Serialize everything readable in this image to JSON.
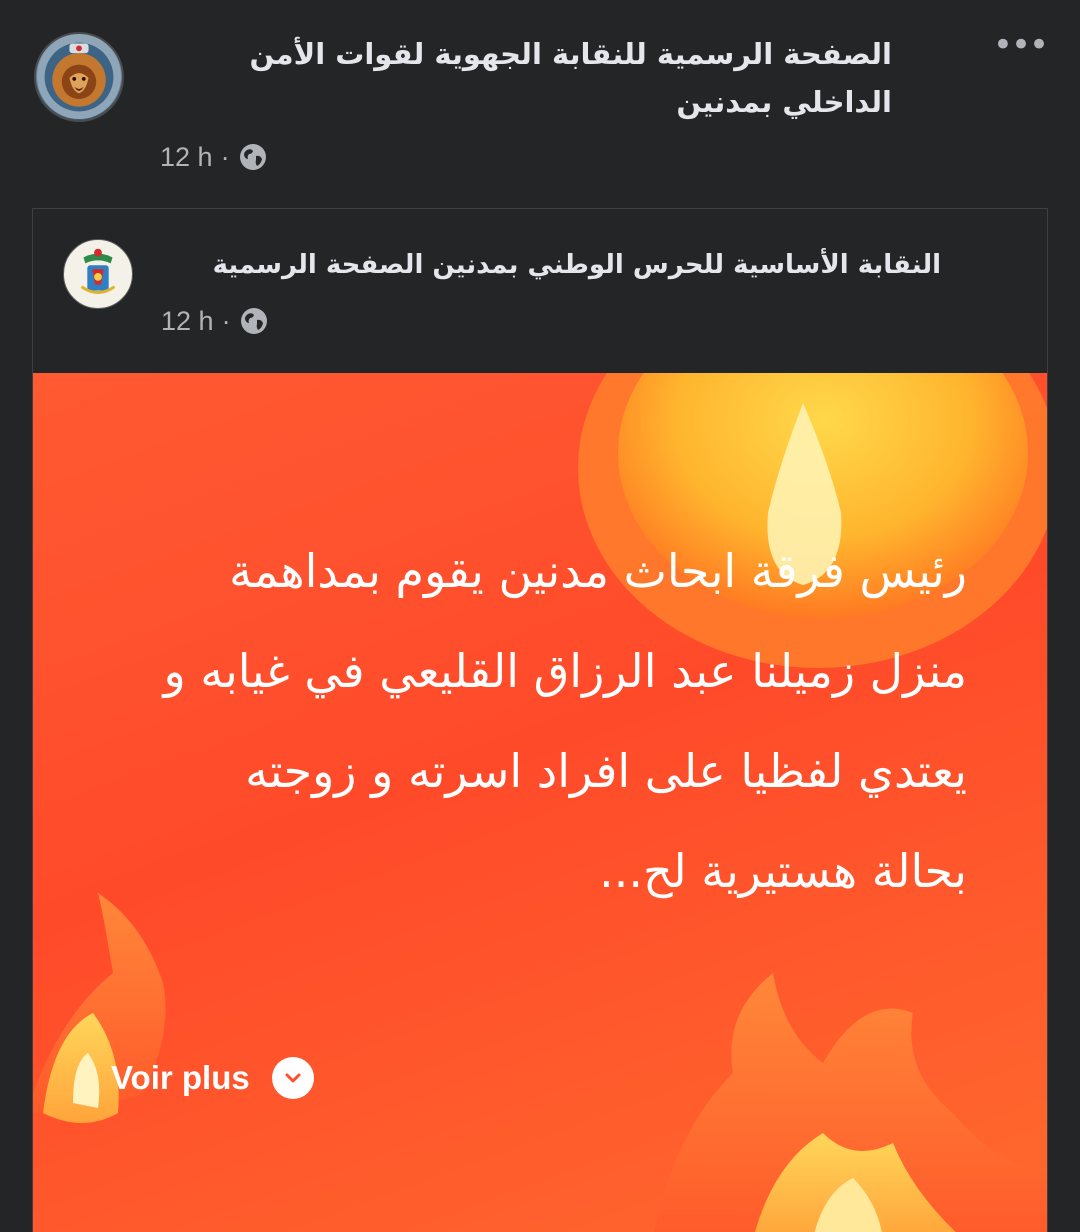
{
  "post": {
    "author": "الصفحة الرسمية للنقابة الجهوية لقوات الأمن الداخلي بمدنين",
    "time": "12 h",
    "separator": "·",
    "privacy_icon": "globe-icon",
    "more_icon": "more-options-icon",
    "more_label": "•••"
  },
  "shared_post": {
    "author": "النقابة الأساسية للحرس الوطني بمدنين الصفحة الرسمية",
    "time": "12 h",
    "separator": "·",
    "privacy_icon": "globe-icon",
    "status_text": "رئيس فرقة ابحاث مدنين يقوم بمداهمة منزل زميلنا عبد الرزاق القليعي في غيابه و يعتدي لفظيا على افراد اسرته و زوجته بحالة هستيرية لح...",
    "see_more_label": "Voir plus",
    "see_more_icon": "chevron-down-icon",
    "background_color": "#ff4f2d"
  },
  "colors": {
    "surface": "#242526",
    "primary_text": "#e4e6eb",
    "secondary_text": "#b0b3b8",
    "status_text": "#ffffff"
  }
}
